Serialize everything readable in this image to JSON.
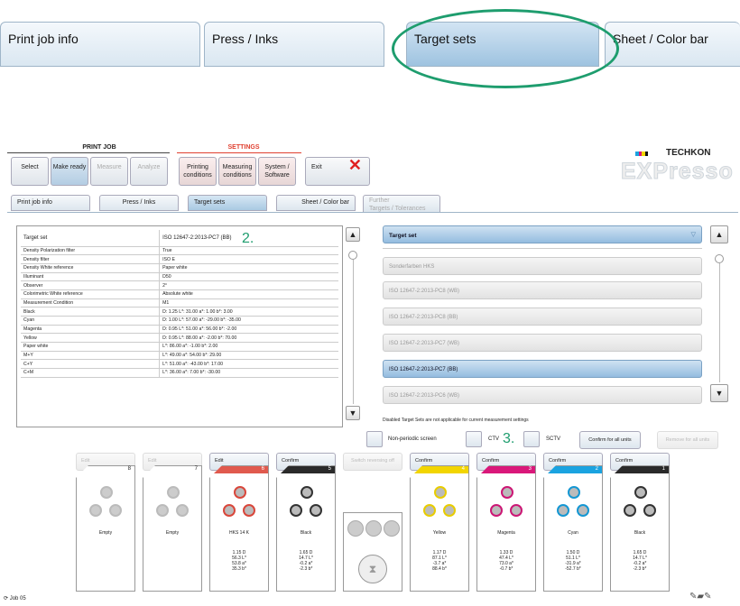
{
  "zoom_tabs": [
    "Print job info",
    "Press / Inks",
    "Target sets",
    "Sheet / Color bar"
  ],
  "app": {
    "group_printjob": "PRINT JOB",
    "group_settings": "SETTINGS",
    "brand": "TECHKON",
    "logo": "EXPresso",
    "topbuttons": [
      {
        "l1": "Select",
        "l2": ""
      },
      {
        "l1": "Make ready",
        "l2": ""
      },
      {
        "l1": "Measure",
        "l2": ""
      },
      {
        "l1": "Analyze",
        "l2": ""
      },
      {
        "l1": "Printing",
        "l2": "conditions"
      },
      {
        "l1": "Measuring",
        "l2": "conditions"
      },
      {
        "l1": "System /",
        "l2": "Software"
      },
      {
        "l1": "Exit",
        "l2": ""
      }
    ],
    "subtabs": [
      "Print job info",
      "Press / Inks",
      "Target sets",
      "Sheet / Color bar"
    ],
    "further_tab_l1": "Further",
    "further_tab_l2": "Targets / Tolerances",
    "table": [
      [
        "Target set",
        "ISO 12647-2:2013-PC7 (BB)"
      ],
      [
        "Density Polarization filter",
        "True"
      ],
      [
        "Density filter",
        "ISO E"
      ],
      [
        "Density White reference",
        "Paper white"
      ],
      [
        "Illuminant",
        "D50"
      ],
      [
        "Observer",
        "2°"
      ],
      [
        "Colorimetric White reference",
        "Absolute white"
      ],
      [
        "Measurement Condition",
        "M1"
      ],
      [
        "Black",
        "D: 1.25 L*: 31.00 a*:  1.00 b*:  3.00"
      ],
      [
        "Cyan",
        "D: 1.00 L*: 57.00 a*: -29.00 b*: -35.00"
      ],
      [
        "Magenta",
        "D: 0.95 L*: 51.00 a*: 56.00 b*: -2.00"
      ],
      [
        "Yellow",
        "D: 0.95 L*: 88.00 a*: -2.00 b*: 70.00"
      ],
      [
        "Paper white",
        "L*: 86.00 a*: -1.00 b*:  2.00"
      ],
      [
        "M+Y",
        "L*: 49.00 a*: 54.00 b*: 29.00"
      ],
      [
        "C+Y",
        "L*: 51.00 a*: -43.00 b*: 17.00"
      ],
      [
        "C+M",
        "L*: 36.00 a*:  7.00 b*: -30.00"
      ]
    ],
    "marker2": "2.",
    "marker3": "3.",
    "targetset_header": "Target set",
    "targetsets": [
      "Sonderfarben HKS",
      "ISO 12647-2:2013-PC8 (WB)",
      "ISO 12647-2:2013-PC8 (BB)",
      "ISO 12647-2:2013-PC7 (WB)",
      "ISO 12647-2:2013-PC7 (BB)",
      "ISO 12647-2:2013-PC6 (WB)"
    ],
    "disabled_note": "Disabled Target Sets are not applicable for current measurement settings",
    "nonperiodic": "Non-periodic screen",
    "ctv": "CTV",
    "sctv": "SCTV",
    "confirm_all": "Confirm for all units",
    "remove_all": "Remove for all units",
    "unit_buttons": [
      "Edit",
      "Edit",
      "Edit",
      "Confirm",
      "Switch reversing off",
      "Confirm",
      "Confirm",
      "Confirm",
      "Confirm"
    ],
    "units": [
      {
        "num": "8",
        "name": "Empty",
        "vals": [
          "",
          "",
          "",
          ""
        ],
        "color": "#bbbbbb",
        "ring": "#bbbbbb"
      },
      {
        "num": "7",
        "name": "Empty",
        "vals": [
          "",
          "",
          "",
          ""
        ],
        "color": "#bbbbbb",
        "ring": "#bbbbbb"
      },
      {
        "num": "6",
        "name": "HKS 14 K",
        "vals": [
          "1.15 D",
          "56.3 L*",
          "53.8 a*",
          "35.3 b*"
        ],
        "color": "#e05a4e",
        "ring": "#d9473b"
      },
      {
        "num": "5",
        "name": "Black",
        "vals": [
          "1.65 D",
          "14.7 L*",
          "-0.2 a*",
          "-2.3 b*"
        ],
        "color": "#2a2a2a",
        "ring": "#333333"
      },
      {
        "num": "4",
        "name": "Yellow",
        "vals": [
          "1.17 D",
          "87.1 L*",
          "-3.7 a*",
          "88.4 b*"
        ],
        "color": "#f2d500",
        "ring": "#e8cc00"
      },
      {
        "num": "3",
        "name": "Magenta",
        "vals": [
          "1.33 D",
          "47.4 L*",
          "73.0 a*",
          "-0.7 b*"
        ],
        "color": "#d9187a",
        "ring": "#cc1775"
      },
      {
        "num": "2",
        "name": "Cyan",
        "vals": [
          "1.50 D",
          "51.1 L*",
          "-31.9 a*",
          "-52.7 b*"
        ],
        "color": "#1aa3e0",
        "ring": "#1597d3"
      },
      {
        "num": "1",
        "name": "Black",
        "vals": [
          "1.65 D",
          "14.7 L*",
          "-0.2 a*",
          "-2.3 b*"
        ],
        "color": "#2a2a2a",
        "ring": "#333333"
      }
    ],
    "status": "Job 05"
  }
}
